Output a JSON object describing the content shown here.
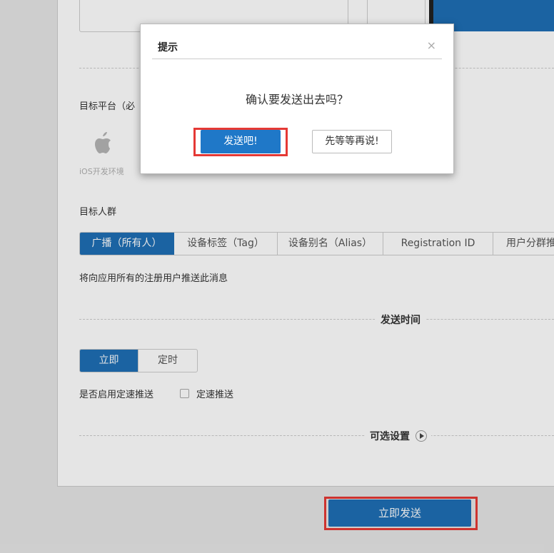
{
  "form": {
    "platform_label": "目标平台（必",
    "platform_caption": "iOS开发环境",
    "audience_label": "目标人群",
    "audience_tabs": [
      {
        "label": "广播（所有人）",
        "active": true
      },
      {
        "label": "设备标签（Tag）",
        "active": false
      },
      {
        "label": "设备别名（Alias）",
        "active": false
      },
      {
        "label": "Registration ID",
        "active": false
      },
      {
        "label": "用户分群推",
        "active": false
      }
    ],
    "audience_hint": "将向应用所有的注册用户推送此消息",
    "send_time_title": "发送时间",
    "send_time_options": {
      "now": "立即",
      "scheduled": "定时"
    },
    "rate_limit_label": "是否启用定速推送",
    "rate_limit_checkbox_label": "定速推送",
    "rate_limit_checked": false,
    "optional_settings_title": "可选设置",
    "send_now_button": "立即发送"
  },
  "dialog": {
    "title": "提示",
    "close_glyph": "×",
    "message": "确认要发送出去吗？",
    "confirm_button": "发送吧!",
    "cancel_button": "先等等再说!"
  },
  "colors": {
    "accent": "#1f6fb5",
    "highlight": "#e53935"
  }
}
